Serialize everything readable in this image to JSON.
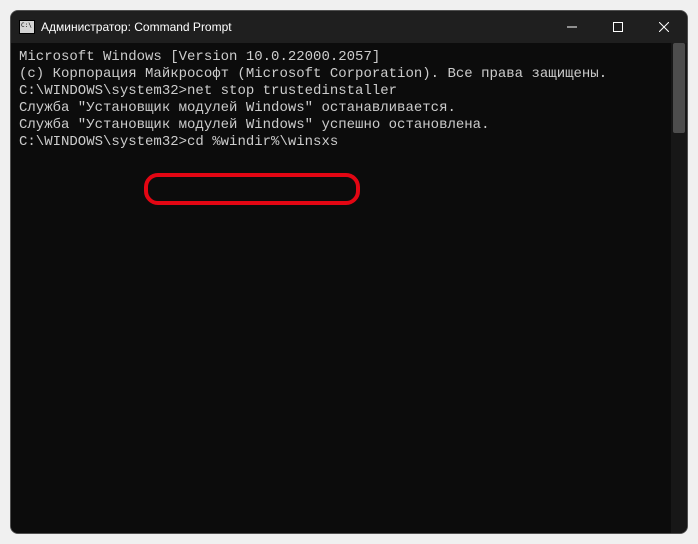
{
  "window": {
    "title": "Администратор: Command Prompt"
  },
  "terminal": {
    "line1": "Microsoft Windows [Version 10.0.22000.2057]",
    "line2": "(c) Корпорация Майкрософт (Microsoft Corporation). Все права защищены.",
    "blank1": "",
    "prompt1": "C:\\WINDOWS\\system32>",
    "cmd1": "net stop trustedinstaller",
    "out1": "Служба \"Установщик модулей Windows\" останавливается.",
    "out2": "Служба \"Установщик модулей Windows\" успешно остановлена.",
    "blank2": "",
    "blank3": "",
    "prompt2": "C:\\WINDOWS\\system32>",
    "cmd2": "cd %windir%\\winsxs"
  }
}
